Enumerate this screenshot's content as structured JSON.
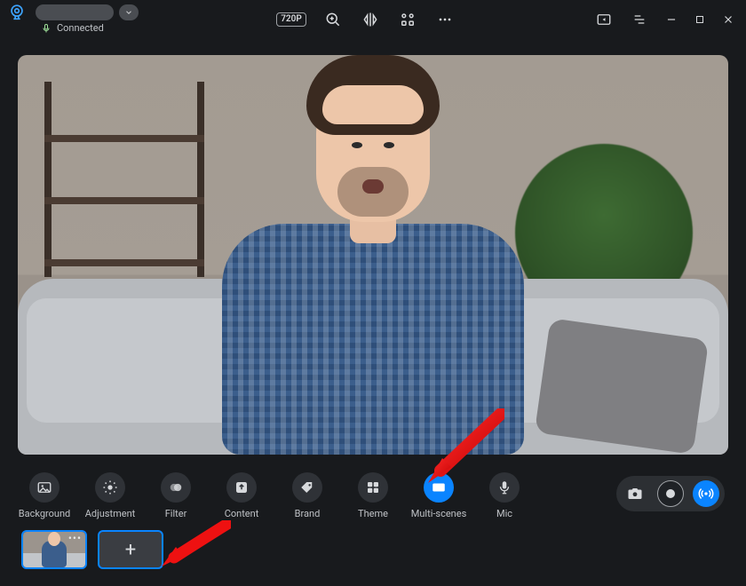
{
  "titlebar": {
    "connection_status": "Connected",
    "quality_badge": "720P"
  },
  "tools": [
    {
      "id": "background",
      "label": "Background",
      "icon": "image",
      "active": false
    },
    {
      "id": "adjustment",
      "label": "Adjustment",
      "icon": "brightness",
      "active": false
    },
    {
      "id": "filter",
      "label": "Filter",
      "icon": "overlap",
      "active": false
    },
    {
      "id": "content",
      "label": "Content",
      "icon": "upload",
      "active": false
    },
    {
      "id": "brand",
      "label": "Brand",
      "icon": "tag",
      "active": false
    },
    {
      "id": "theme",
      "label": "Theme",
      "icon": "grid2",
      "active": false
    },
    {
      "id": "multi-scenes",
      "label": "Multi-scenes",
      "icon": "scene",
      "active": true
    },
    {
      "id": "mic",
      "label": "Mic",
      "icon": "mic",
      "active": false
    }
  ],
  "scenes": {
    "thumb_menu_glyph": "•••",
    "add_glyph": "+"
  },
  "colors": {
    "accent": "#0a84ff",
    "bg": "#181a1d",
    "panel": "#2f3237",
    "text": "#d7d9dc"
  }
}
